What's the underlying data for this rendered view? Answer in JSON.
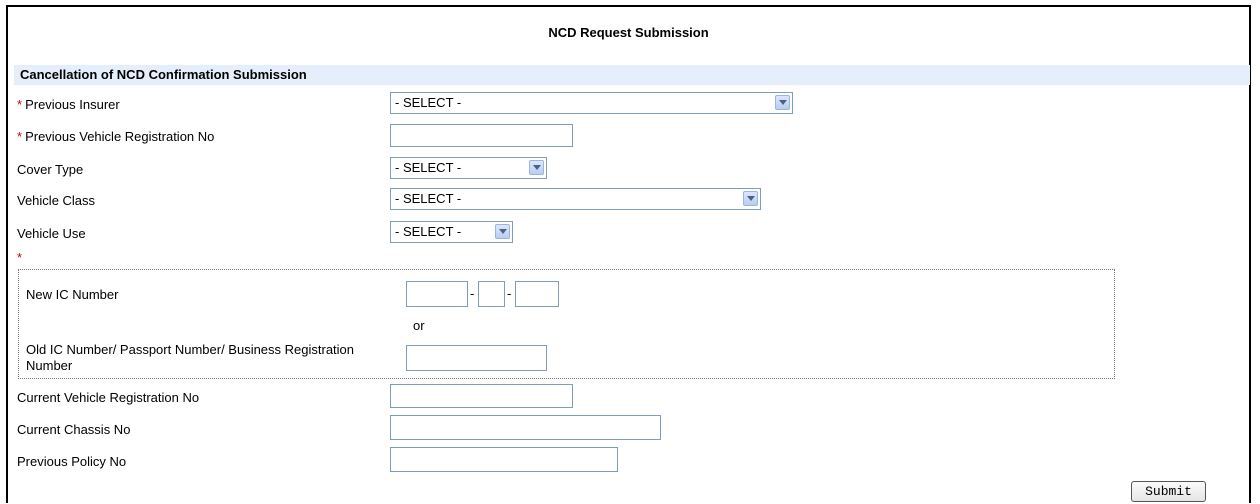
{
  "page": {
    "title": "NCD Request Submission"
  },
  "section": {
    "header": "Cancellation of NCD Confirmation Submission"
  },
  "fields": {
    "required_marker": "*",
    "previous_insurer": {
      "label": "Previous Insurer",
      "value": "- SELECT -",
      "required": true
    },
    "previous_vehicle_reg": {
      "label": "Previous Vehicle Registration No",
      "value": "",
      "required": true
    },
    "cover_type": {
      "label": "Cover Type",
      "value": "- SELECT -"
    },
    "vehicle_class": {
      "label": "Vehicle Class",
      "value": "- SELECT -"
    },
    "vehicle_use": {
      "label": "Vehicle Use",
      "value": "- SELECT -"
    },
    "id_group": {
      "new_ic_label": "New IC Number",
      "separator": "-",
      "or_text": "or",
      "old_ic_label": "Old IC Number/ Passport Number/ Business Registration Number"
    },
    "current_vehicle_reg": {
      "label": "Current Vehicle Registration No",
      "value": ""
    },
    "current_chassis": {
      "label": "Current Chassis No",
      "value": ""
    },
    "previous_policy": {
      "label": "Previous Policy No",
      "value": ""
    }
  },
  "actions": {
    "submit_label": "Submit"
  }
}
